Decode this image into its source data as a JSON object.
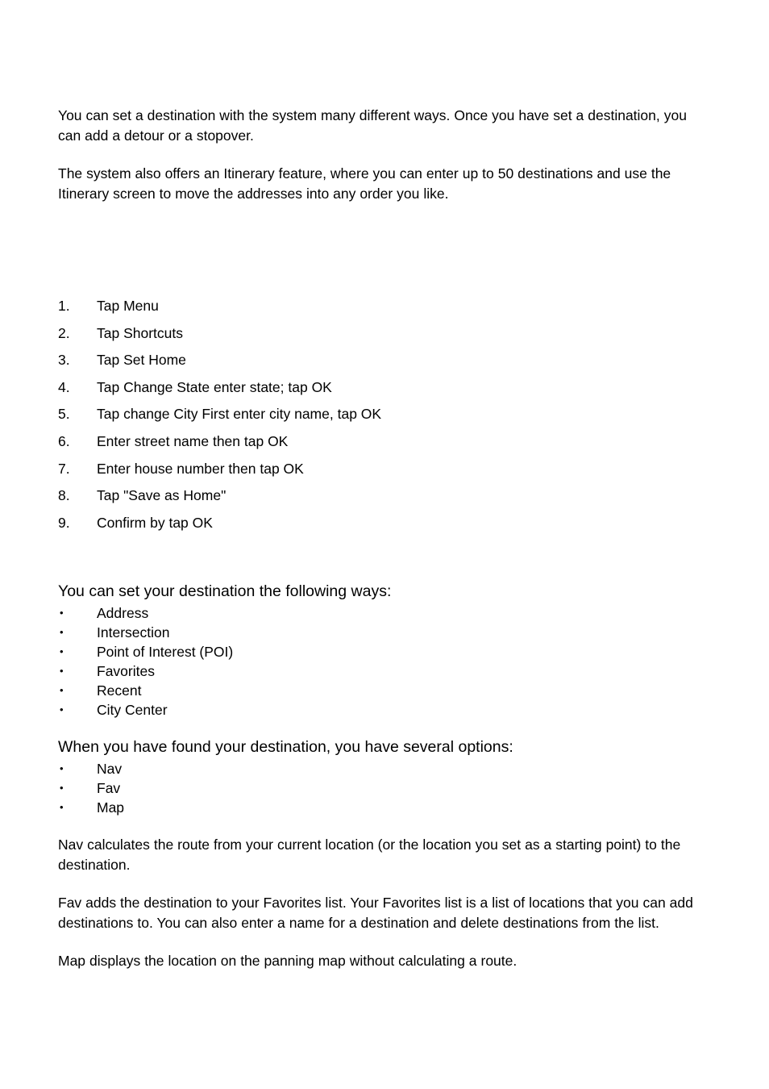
{
  "document": {
    "intro_paragraphs": [
      "You can set a destination with the system many different ways. Once you have set a destination, you can add a detour or a stopover.",
      "The system also offers an Itinerary feature, where you can enter up to 50 destinations and use the Itinerary screen to move the addresses into any order you like."
    ],
    "procedure": {
      "steps": [
        {
          "number": "1.",
          "text": "Tap Menu"
        },
        {
          "number": "2.",
          "text": "Tap Shortcuts"
        },
        {
          "number": "3.",
          "text": "Tap Set Home"
        },
        {
          "number": "4.",
          "text": "Tap Change State enter state; tap OK"
        },
        {
          "number": "5.",
          "text": "Tap change City First enter city name, tap OK"
        },
        {
          "number": "6.",
          "text": "Enter street name then tap OK"
        },
        {
          "number": "7.",
          "text": "Enter house number then tap OK"
        },
        {
          "number": "8.",
          "text": "Tap \"Save as Home\""
        },
        {
          "number": "9.",
          "text": "Confirm by tap OK"
        }
      ]
    },
    "destination_methods": {
      "heading": "You can set your destination the following ways:",
      "bullet": "•",
      "items": [
        "Address",
        "Intersection",
        "Point of Interest (POI)",
        "Favorites",
        "Recent",
        "City Center"
      ]
    },
    "destination_options": {
      "heading": "When you have found your destination, you have several options:",
      "bullet": "•",
      "items": [
        "Nav",
        "Fav",
        "Map"
      ]
    },
    "closing_paragraphs": [
      "Nav calculates the route from your current location (or the location you set as a starting point) to the destination.",
      "Fav adds the destination to your Favorites list. Your Favorites list is a list of locations that you can add destinations to. You can also enter a name for a destination and delete destinations from the list.",
      "Map displays the location on the panning map without calculating a route."
    ]
  }
}
